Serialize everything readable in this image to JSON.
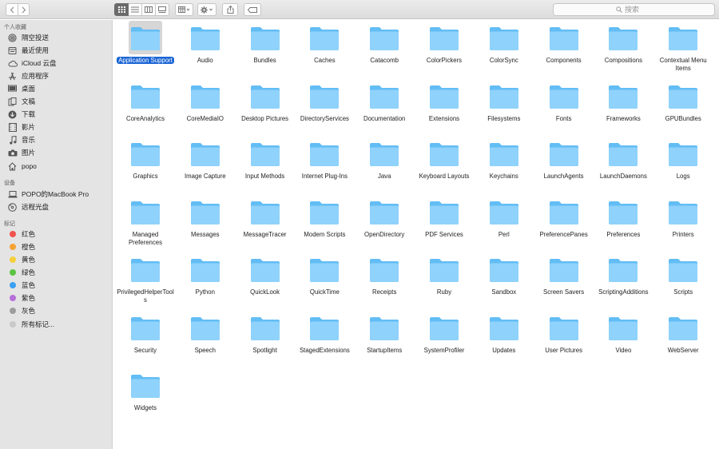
{
  "search": {
    "placeholder": "搜索"
  },
  "sidebar": {
    "favorites_title": "个人收藏",
    "favorites": [
      {
        "label": "隔空投送",
        "icon": "airdrop-icon"
      },
      {
        "label": "最近使用",
        "icon": "recents-icon"
      },
      {
        "label": "iCloud 云盘",
        "icon": "cloud-icon"
      },
      {
        "label": "应用程序",
        "icon": "applications-icon"
      },
      {
        "label": "桌面",
        "icon": "desktop-icon"
      },
      {
        "label": "文稿",
        "icon": "documents-icon"
      },
      {
        "label": "下载",
        "icon": "downloads-icon"
      },
      {
        "label": "影片",
        "icon": "movies-icon"
      },
      {
        "label": "音乐",
        "icon": "music-icon"
      },
      {
        "label": "图片",
        "icon": "pictures-icon"
      },
      {
        "label": "popo",
        "icon": "home-icon"
      }
    ],
    "devices_title": "设备",
    "devices": [
      {
        "label": "POPO的MacBook Pro",
        "icon": "laptop-icon"
      },
      {
        "label": "远程光盘",
        "icon": "disc-icon"
      }
    ],
    "tags_title": "标记",
    "tags": [
      {
        "label": "红色",
        "color": "#f2534e"
      },
      {
        "label": "橙色",
        "color": "#f6a236"
      },
      {
        "label": "黄色",
        "color": "#f5cf3a"
      },
      {
        "label": "绿色",
        "color": "#5bc442"
      },
      {
        "label": "蓝色",
        "color": "#3ba0f2"
      },
      {
        "label": "紫色",
        "color": "#b66fd9"
      },
      {
        "label": "灰色",
        "color": "#9d9d9d"
      },
      {
        "label": "所有标记...",
        "color": "#c9c9c9"
      }
    ]
  },
  "folders": [
    "Application Support",
    "Audio",
    "Bundles",
    "Caches",
    "Catacomb",
    "ColorPickers",
    "ColorSync",
    "Components",
    "Compositions",
    "Contextual Menu Items",
    "CoreAnalytics",
    "CoreMediaIO",
    "Desktop Pictures",
    "DirectoryServices",
    "Documentation",
    "Extensions",
    "Filesystems",
    "Fonts",
    "Frameworks",
    "GPUBundles",
    "Graphics",
    "Image Capture",
    "Input Methods",
    "Internet Plug-Ins",
    "Java",
    "Keyboard Layouts",
    "Keychains",
    "LaunchAgents",
    "LaunchDaemons",
    "Logs",
    "Managed Preferences",
    "Messages",
    "MessageTracer",
    "Modem Scripts",
    "OpenDirectory",
    "PDF Services",
    "Perl",
    "PreferencePanes",
    "Preferences",
    "Printers",
    "PrivilegedHelperTools",
    "Python",
    "QuickLook",
    "QuickTime",
    "Receipts",
    "Ruby",
    "Sandbox",
    "Screen Savers",
    "ScriptingAdditions",
    "Scripts",
    "Security",
    "Speech",
    "Spotlight",
    "StagedExtensions",
    "StartupItems",
    "SystemProfiler",
    "Updates",
    "User Pictures",
    "Video",
    "WebServer",
    "Widgets"
  ],
  "selected_folder": "Application Support",
  "colors": {
    "folder_light": "#8fd2fb",
    "folder_dark": "#63bdf5",
    "selection": "#1a64d4"
  }
}
